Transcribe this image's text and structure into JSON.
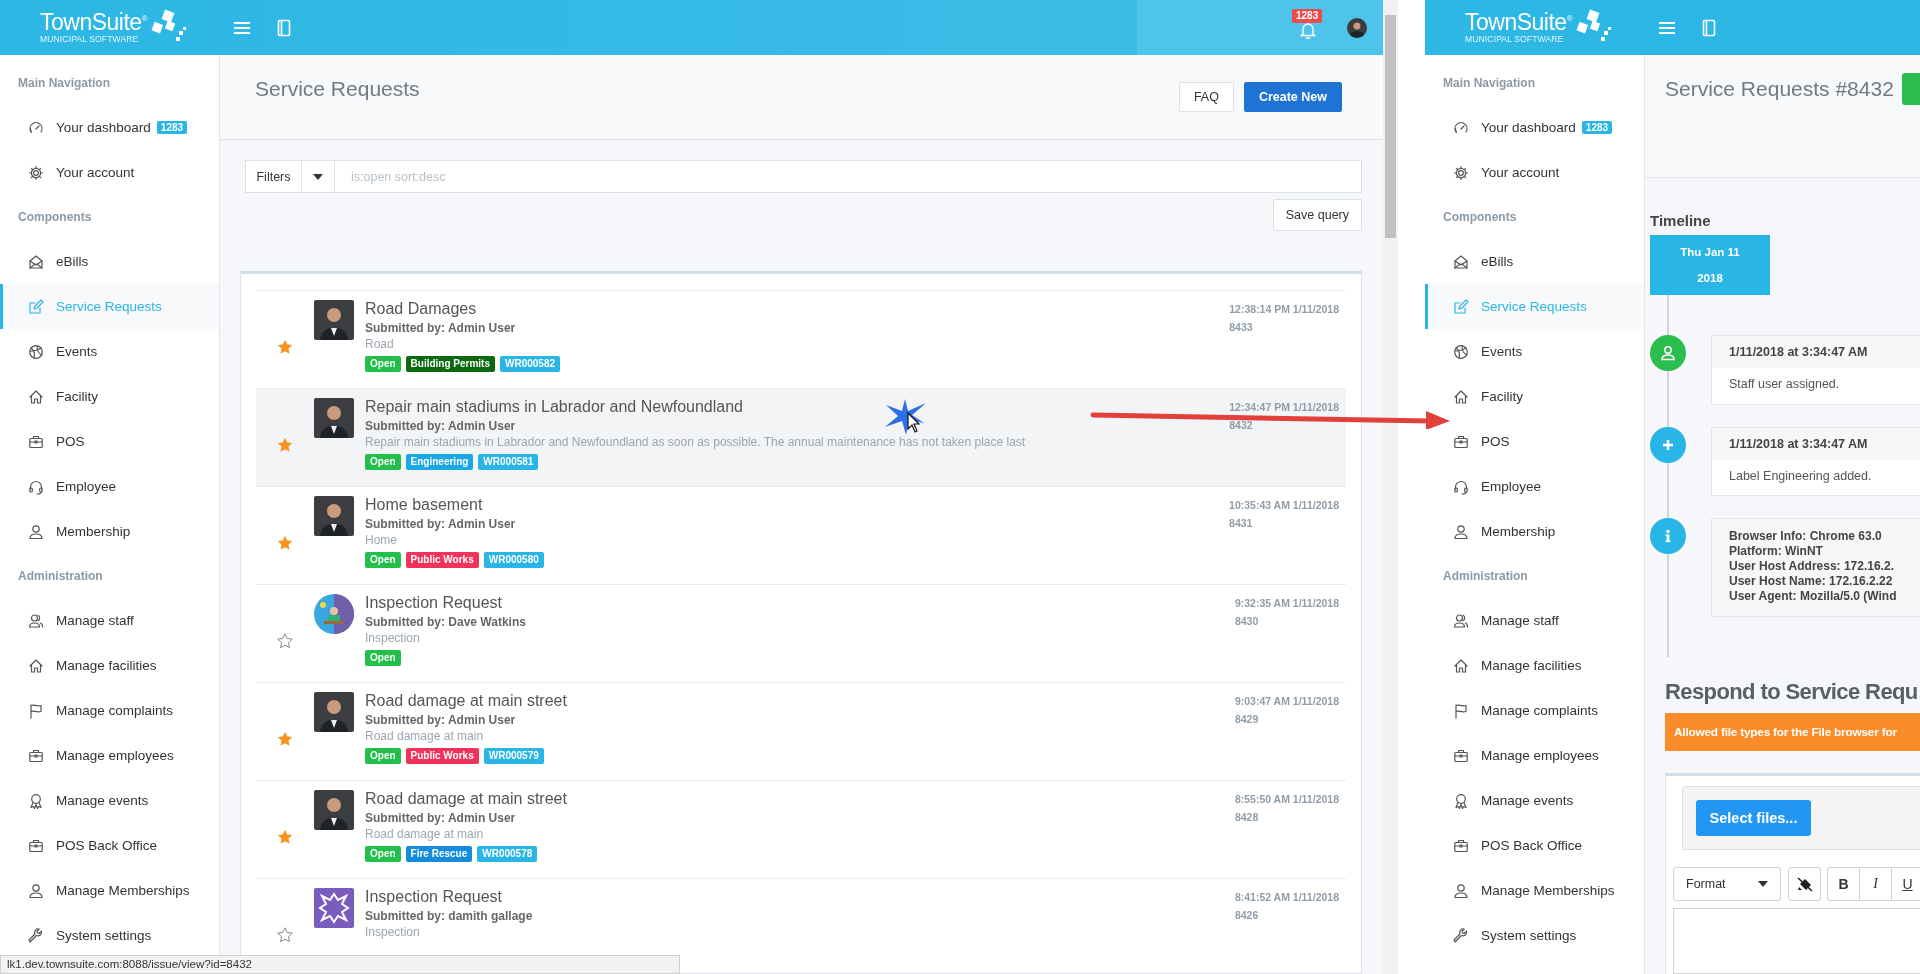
{
  "left_window": {
    "header": {
      "logo": "TownSuite$^{®}$",
      "logo_tagline": "MUNICIPAL SOFTWARE",
      "notification_count": "1283"
    },
    "sidebar": [
      {
        "title": "Main Navigation",
        "items": [
          {
            "kind": "gauge",
            "label": "Your dashboard",
            "badge": "1283",
            "selected": false
          },
          {
            "kind": "gear",
            "label": "Your account",
            "selected": false
          }
        ]
      },
      {
        "title": "Components",
        "items": [
          {
            "kind": "envelope",
            "label": "eBills",
            "selected": false
          },
          {
            "kind": "edit",
            "label": "Service Requests",
            "selected": true
          },
          {
            "kind": "ball",
            "label": "Events",
            "selected": false
          },
          {
            "kind": "house",
            "label": "Facility",
            "selected": false
          },
          {
            "kind": "briefcase",
            "label": "POS",
            "selected": false
          },
          {
            "kind": "headset",
            "label": "Employee",
            "selected": false
          },
          {
            "kind": "person",
            "label": "Membership",
            "selected": false
          }
        ]
      },
      {
        "title": "Administration",
        "items": [
          {
            "kind": "people",
            "label": "Manage staff",
            "selected": false
          },
          {
            "kind": "house",
            "label": "Manage facilities",
            "selected": false
          },
          {
            "kind": "flag",
            "label": "Manage complaints",
            "selected": false
          },
          {
            "kind": "briefcase",
            "label": "Manage employees",
            "selected": false
          },
          {
            "kind": "award",
            "label": "Manage events",
            "selected": false
          },
          {
            "kind": "briefcase",
            "label": "POS Back Office",
            "selected": false
          },
          {
            "kind": "person",
            "label": "Manage Memberships",
            "selected": false
          },
          {
            "kind": "wrench",
            "label": "System settings",
            "selected": false
          }
        ]
      }
    ],
    "page_title": "Service Requests",
    "actions": [
      {
        "label": "FAQ",
        "kind": "plain"
      },
      {
        "label": "Create New",
        "kind": "primary"
      }
    ],
    "filter": {
      "button": "Filters",
      "placeholder": "is:open sort:desc",
      "save": "Save query"
    },
    "requests": [
      {
        "starred": true,
        "hovered": false,
        "avatar": {
          "kind": "photo"
        },
        "title": "Road Damages",
        "submitted": "Submitted by: Admin User",
        "description": "Road",
        "tags": [
          {
            "label": "Open",
            "color": "#22bf4b"
          },
          {
            "label": "Building Permits",
            "color": "#0b6a10"
          },
          {
            "label": "WR000582",
            "color": "#29b6e6"
          }
        ],
        "time": "12:38:14 PM 1/11/2018",
        "id": "8433"
      },
      {
        "starred": true,
        "hovered": true,
        "avatar": {
          "kind": "photo"
        },
        "title": "Repair main stadiums in Labrador and Newfoundland",
        "submitted": "Submitted by: Admin User",
        "description": "Repair main stadiums in Labrador and Newfoundland as soon as possible. The annual maintenance has not taken place last",
        "tags": [
          {
            "label": "Open",
            "color": "#22bf4b"
          },
          {
            "label": "Engineering",
            "color": "#1aa9e4"
          },
          {
            "label": "WR000581",
            "color": "#29b6e6"
          }
        ],
        "time": "12:34:47 PM 1/11/2018",
        "id": "8432"
      },
      {
        "starred": true,
        "hovered": false,
        "avatar": {
          "kind": "photo"
        },
        "title": "Home basement",
        "submitted": "Submitted by: Admin User",
        "description": "Home",
        "tags": [
          {
            "label": "Open",
            "color": "#22bf4b"
          },
          {
            "label": "Public Works",
            "color": "#f1325b"
          },
          {
            "label": "WR000580",
            "color": "#29b6e6"
          }
        ],
        "time": "10:35:43 AM 1/11/2018",
        "id": "8431"
      },
      {
        "starred": false,
        "hovered": false,
        "avatar": {
          "kind": "illustration"
        },
        "title": "Inspection Request",
        "submitted": "Submitted by: Dave Watkins",
        "description": "Inspection",
        "tags": [
          {
            "label": "Open",
            "color": "#22bf4b"
          }
        ],
        "time": "9:32:35 AM 1/11/2018",
        "id": "8430"
      },
      {
        "starred": true,
        "hovered": false,
        "avatar": {
          "kind": "photo"
        },
        "title": "Road damage at main street",
        "submitted": "Submitted by: Admin User",
        "description": "Road damage at main",
        "tags": [
          {
            "label": "Open",
            "color": "#22bf4b"
          },
          {
            "label": "Public Works",
            "color": "#f1325b"
          },
          {
            "label": "WR000579",
            "color": "#29b6e6"
          }
        ],
        "time": "9:03:47 AM 1/11/2018",
        "id": "8429"
      },
      {
        "starred": true,
        "hovered": false,
        "avatar": {
          "kind": "photo"
        },
        "title": "Road damage at main street",
        "submitted": "Submitted by: Admin User",
        "description": "Road damage at main",
        "tags": [
          {
            "label": "Open",
            "color": "#22bf4b"
          },
          {
            "label": "Fire Rescue",
            "color": "#138ddb"
          },
          {
            "label": "WR000578",
            "color": "#29b6e6"
          }
        ],
        "time": "8:55:50 AM 1/11/2018",
        "id": "8428"
      },
      {
        "starred": false,
        "hovered": false,
        "avatar": {
          "kind": "pattern"
        },
        "title": "Inspection Request",
        "submitted": "Submitted by: damith gallage",
        "description": "Inspection",
        "time": "8:41:52 AM 1/11/2018",
        "id": "8426"
      }
    ],
    "status_url": "lk1.dev.townsuite.com:8088/issue/view?id=8432"
  },
  "right_window": {
    "header": {
      "logo": "TownSuite$^{®}$",
      "logo_tagline": "MUNICIPAL SOFTWARE"
    },
    "sidebar": [
      {
        "title": "Main Navigation",
        "items": [
          {
            "kind": "gauge",
            "label": "Your dashboard",
            "badge": "1283",
            "selected": false
          },
          {
            "kind": "gear",
            "label": "Your account",
            "selected": false
          }
        ]
      },
      {
        "title": "Components",
        "items": [
          {
            "kind": "envelope",
            "label": "eBills",
            "selected": false
          },
          {
            "kind": "edit",
            "label": "Service Requests",
            "selected": true
          },
          {
            "kind": "ball",
            "label": "Events",
            "selected": false
          },
          {
            "kind": "house",
            "label": "Facility",
            "selected": false
          },
          {
            "kind": "briefcase",
            "label": "POS",
            "selected": false
          },
          {
            "kind": "headset",
            "label": "Employee",
            "selected": false
          },
          {
            "kind": "person",
            "label": "Membership",
            "selected": false
          }
        ]
      },
      {
        "title": "Administration",
        "items": [
          {
            "kind": "people",
            "label": "Manage staff",
            "selected": false
          },
          {
            "kind": "house",
            "label": "Manage facilities",
            "selected": false
          },
          {
            "kind": "flag",
            "label": "Manage complaints",
            "selected": false
          },
          {
            "kind": "briefcase",
            "label": "Manage employees",
            "selected": false
          },
          {
            "kind": "award",
            "label": "Manage events",
            "selected": false
          },
          {
            "kind": "briefcase",
            "label": "POS Back Office",
            "selected": false
          },
          {
            "kind": "person",
            "label": "Manage Memberships",
            "selected": false
          },
          {
            "kind": "wrench",
            "label": "System settings",
            "selected": false
          }
        ]
      }
    ],
    "page_title": "Service Requests #8432",
    "timeline": {
      "title": "Timeline",
      "date": "Thu Jan 11",
      "year": "2018",
      "events": [
        {
          "kind": "user",
          "color": "#2cbd4f",
          "heading": "1/11/2018 at 3:34:47 AM",
          "lines": [
            "Staff user assigned."
          ]
        },
        {
          "kind": "add",
          "color": "#29b6e6",
          "heading": "1/11/2018 at 3:34:47 AM",
          "lines": [
            "Label Engineering added."
          ]
        },
        {
          "kind": "info",
          "color": "#29b6e6",
          "lines": [
            "Browser Info: Chrome 63.0",
            "Platform: WinNT",
            "User Host Address: 172.16.2.",
            "User Host Name: 172.16.2.22",
            "User Agent: Mozilla/5.0 (Wind"
          ]
        }
      ]
    },
    "respond": {
      "title": "Respond to Service Requ",
      "notice": "Allowed file types for the File browser for",
      "select_button": "Select files...",
      "format": "Format",
      "format_buttons": [
        {
          "label": "B",
          "kind": "bold"
        },
        {
          "label": "I",
          "kind": "italic"
        },
        {
          "label": "U",
          "kind": "underline"
        }
      ]
    }
  }
}
